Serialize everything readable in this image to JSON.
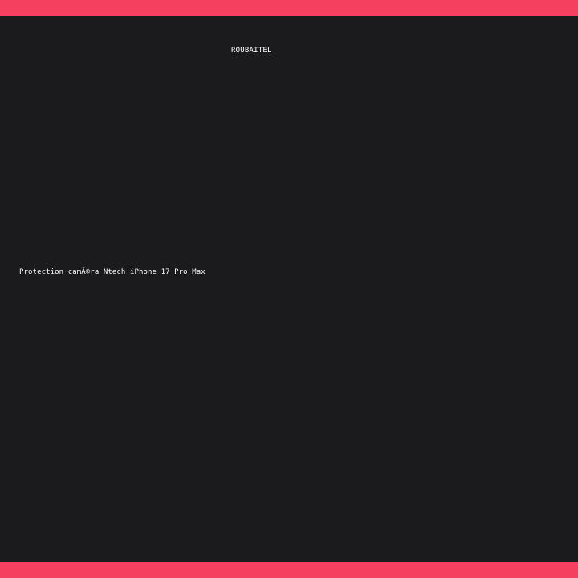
{
  "brand": {
    "name": "ROUBAITEL"
  },
  "product": {
    "title": "Protection camÃ©ra Ntech iPhone 17 Pro Max"
  },
  "colors": {
    "accent_bar": "#f5405f",
    "background": "#1b1b1d",
    "text": "#ffffff"
  }
}
